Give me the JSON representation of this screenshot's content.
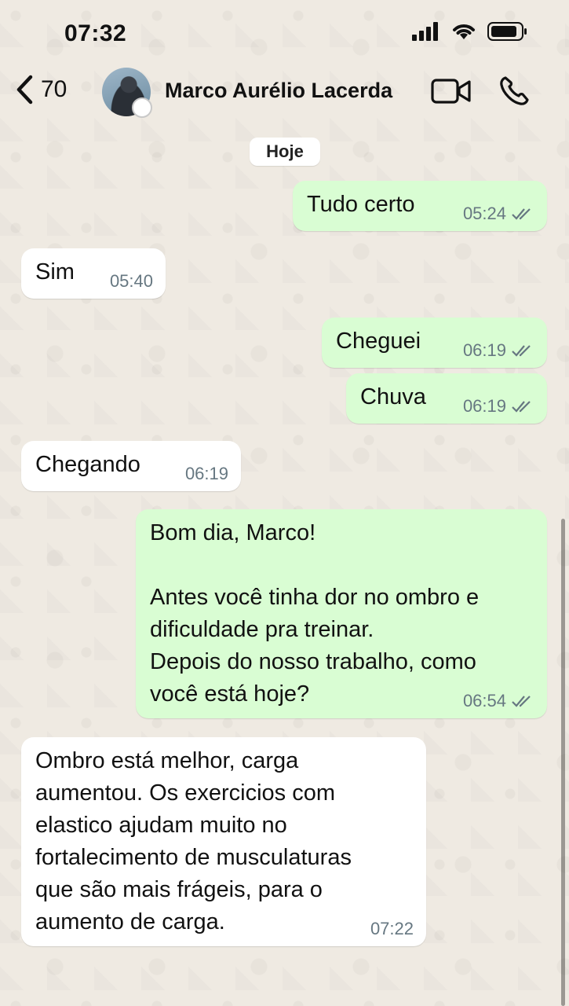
{
  "status_bar": {
    "time": "07:32"
  },
  "header": {
    "back_count": "70",
    "contact_name": "Marco Aurélio Lacerda"
  },
  "date_chip": "Hoje",
  "messages": [
    {
      "direction": "out",
      "text": "Tudo certo",
      "time": "05:24"
    },
    {
      "direction": "in",
      "text": "Sim",
      "time": "05:40"
    },
    {
      "direction": "out",
      "text": "Cheguei",
      "time": "06:19"
    },
    {
      "direction": "out",
      "text": "Chuva",
      "time": "06:19"
    },
    {
      "direction": "in",
      "text": "Chegando",
      "time": "06:19"
    },
    {
      "direction": "out",
      "text": "Bom dia, Marco!\n\nAntes você tinha dor no ombro e\ndificuldade pra treinar.\nDepois do nosso trabalho, como\nvocê está hoje?",
      "time": "06:54"
    },
    {
      "direction": "in",
      "text": "Ombro está melhor, carga\naumentou. Os exercicios com\nelastico ajudam muito no\nfortalecimento de musculaturas\nque são mais frágeis, para o\naumento de carga.",
      "time": "07:22"
    }
  ],
  "colors": {
    "outgoing_bubble": "#d9fdd3",
    "incoming_bubble": "#ffffff",
    "wallpaper": "#efeae2",
    "meta_text": "#667781"
  },
  "icons": [
    "back-chevron-icon",
    "signal-icon",
    "wifi-icon",
    "battery-icon",
    "video-call-icon",
    "voice-call-icon",
    "read-receipt-icon"
  ]
}
